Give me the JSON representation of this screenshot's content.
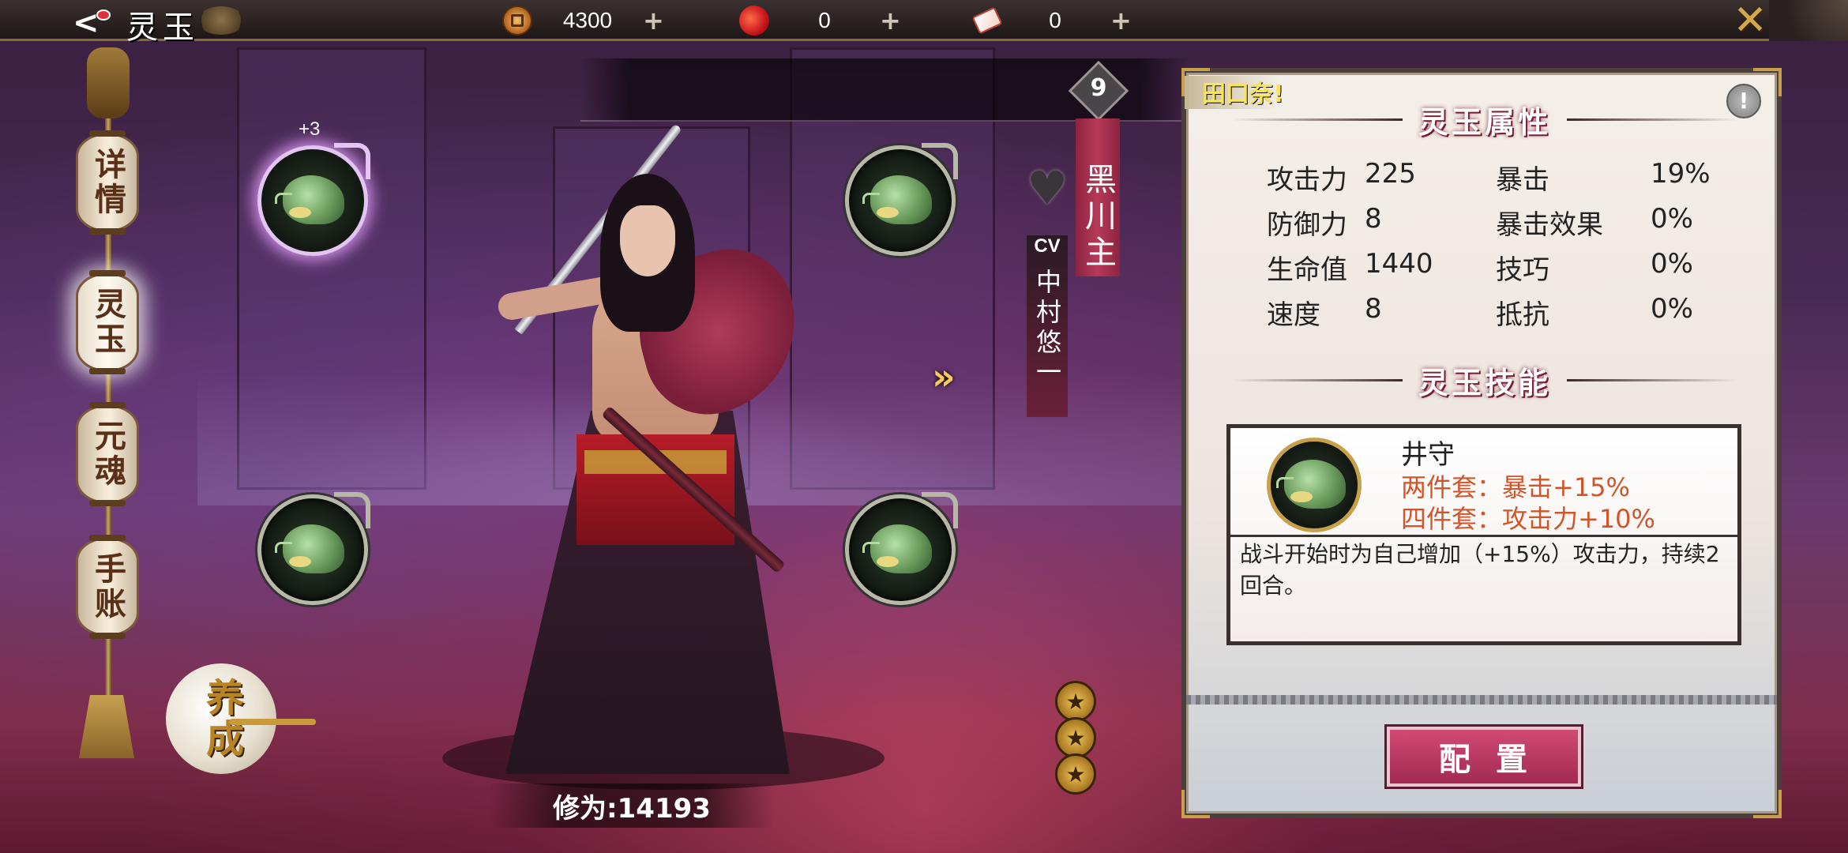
{
  "header": {
    "title": "灵玉",
    "currencies": [
      {
        "icon": "coin-icon",
        "value": "4300"
      },
      {
        "icon": "magatama-icon",
        "value": "0"
      },
      {
        "icon": "ticket-icon",
        "value": "0"
      }
    ],
    "plus": "+",
    "close": "✕"
  },
  "sidebar": {
    "items": [
      {
        "label": "详情"
      },
      {
        "label": "灵玉"
      },
      {
        "label": "元魂"
      },
      {
        "label": "手账"
      }
    ],
    "cultivate": "养成"
  },
  "slots": {
    "top_left_level": "+3"
  },
  "character": {
    "level": "9",
    "name": "黑川主",
    "cv_label": "CV",
    "cv_name": "中村悠一",
    "cultivation": "修为:14193",
    "forward_arrow": "»"
  },
  "panel": {
    "tab_label": "田口奈!",
    "info": "!",
    "attr_title": "灵玉属性",
    "stats": [
      {
        "name": "攻击力",
        "value": "225",
        "name2": "暴击",
        "value2": "19%"
      },
      {
        "name": "防御力",
        "value": "8",
        "name2": "暴击效果",
        "value2": "0%"
      },
      {
        "name": "生命值",
        "value": "1440",
        "name2": "技巧",
        "value2": "0%"
      },
      {
        "name": "速度",
        "value": "8",
        "name2": "抵抗",
        "value2": "0%"
      }
    ],
    "skill_title": "灵玉技能",
    "skill": {
      "name": "井守",
      "set2": "两件套：暴击+15%",
      "set4": "四件套：攻击力+10%",
      "desc": "战斗开始时为自己增加（+15%）攻击力，持续2回合。"
    },
    "config_button": "配置"
  }
}
